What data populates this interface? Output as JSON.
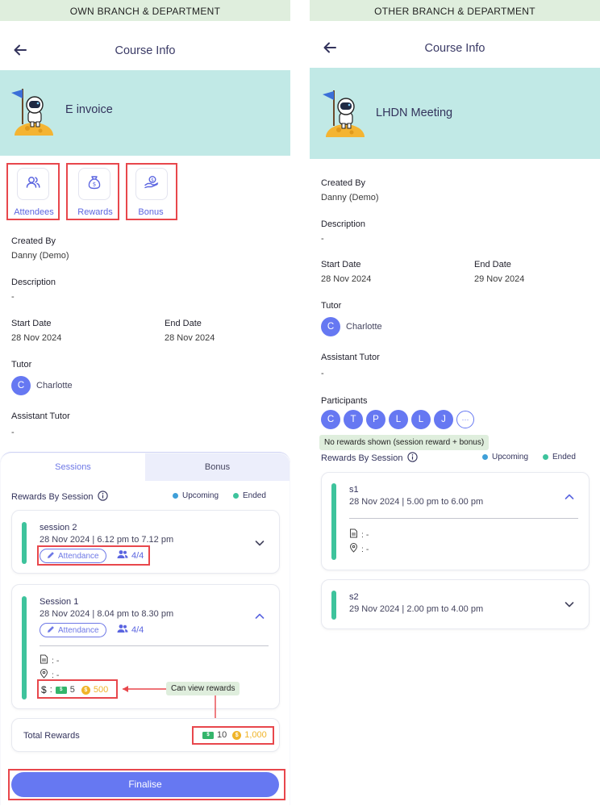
{
  "left": {
    "banner": "OWN BRANCH & DEPARTMENT",
    "header_title": "Course Info",
    "course_title": "E invoice",
    "actions": [
      {
        "label": "Attendees",
        "icon": "users-icon"
      },
      {
        "label": "Rewards",
        "icon": "money-bag-icon"
      },
      {
        "label": "Bonus",
        "icon": "coin-hand-icon"
      }
    ],
    "created_by_label": "Created By",
    "created_by": "Danny (Demo)",
    "description_label": "Description",
    "description": "-",
    "start_date_label": "Start Date",
    "start_date": "28 Nov 2024",
    "end_date_label": "End Date",
    "end_date": "28 Nov 2024",
    "tutor_label": "Tutor",
    "tutor_initial": "C",
    "tutor_name": "Charlotte",
    "assistant_label": "Assistant Tutor",
    "assistant": "-",
    "tabs": [
      "Sessions",
      "Bonus"
    ],
    "rewards_by_session_label": "Rewards By Session",
    "legend_upcoming": "Upcoming",
    "legend_ended": "Ended",
    "sessions": [
      {
        "name": "session 2",
        "time": "28 Nov 2024 | 6.12 pm to 7.12 pm",
        "attendance_label": "Attendance",
        "attendance_count": "4/4"
      },
      {
        "name": "Session 1",
        "time": "28 Nov 2024 | 8.04 pm to 8.30 pm",
        "attendance_label": "Attendance",
        "attendance_count": "4/4",
        "doc": ": -",
        "location": ": -",
        "reward_prefix": ":",
        "cash": "5",
        "coins": "500"
      }
    ],
    "tooltip": "Can view rewards",
    "total_rewards_label": "Total Rewards",
    "total_cash": "10",
    "total_coins": "1,000",
    "finalise_label": "Finalise"
  },
  "right": {
    "banner": "OTHER BRANCH & DEPARTMENT",
    "header_title": "Course Info",
    "course_title": "LHDN Meeting",
    "created_by_label": "Created By",
    "created_by": "Danny (Demo)",
    "description_label": "Description",
    "description": "-",
    "start_date_label": "Start Date",
    "start_date": "28 Nov 2024",
    "end_date_label": "End Date",
    "end_date": "29 Nov 2024",
    "tutor_label": "Tutor",
    "tutor_initial": "C",
    "tutor_name": "Charlotte",
    "assistant_label": "Assistant Tutor",
    "assistant": "-",
    "participants_label": "Participants",
    "participants": [
      "C",
      "T",
      "P",
      "L",
      "L",
      "J"
    ],
    "more_label": "···",
    "note": "No rewards shown (session reward + bonus)",
    "rewards_by_session_label": "Rewards By Session",
    "legend_upcoming": "Upcoming",
    "legend_ended": "Ended",
    "sessions": [
      {
        "name": "s1",
        "time": "28 Nov 2024 | 5.00 pm to 6.00 pm",
        "doc": ": -",
        "location": ": -"
      },
      {
        "name": "s2",
        "time": "29 Nov 2024 | 2.00 pm to 4.00 pm"
      }
    ]
  },
  "colors": {
    "accent": "#6678f2",
    "hero_bg": "#c1e9e6",
    "banner_bg": "#dfeedd",
    "ended": "#3ec39c",
    "upcoming": "#3f9fd8",
    "highlight": "#e8474c"
  }
}
